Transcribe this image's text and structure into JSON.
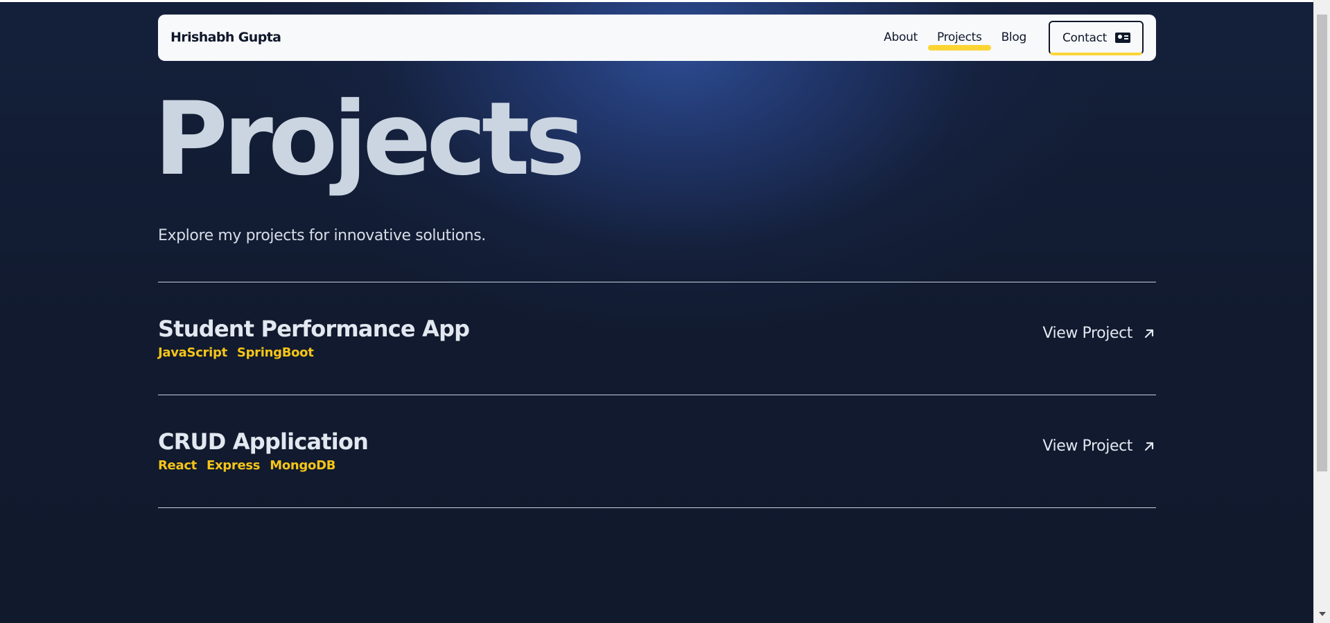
{
  "header": {
    "brand": "Hrishabh Gupta",
    "nav": [
      {
        "label": "About"
      },
      {
        "label": "Projects"
      },
      {
        "label": "Blog"
      }
    ],
    "contact_label": "Contact",
    "accent_color": "#fcd535"
  },
  "hero": {
    "title": "Projects",
    "subtitle": "Explore my projects for innovative solutions."
  },
  "projects": [
    {
      "title": "Student Performance App",
      "tags": [
        "JavaScript",
        "SpringBoot"
      ],
      "link_label": "View Project"
    },
    {
      "title": "CRUD Application",
      "tags": [
        "React",
        "Express",
        "MongoDB"
      ],
      "link_label": "View Project"
    }
  ],
  "icons": {
    "contact": "contact-card-icon",
    "external": "arrow-up-right-icon"
  }
}
